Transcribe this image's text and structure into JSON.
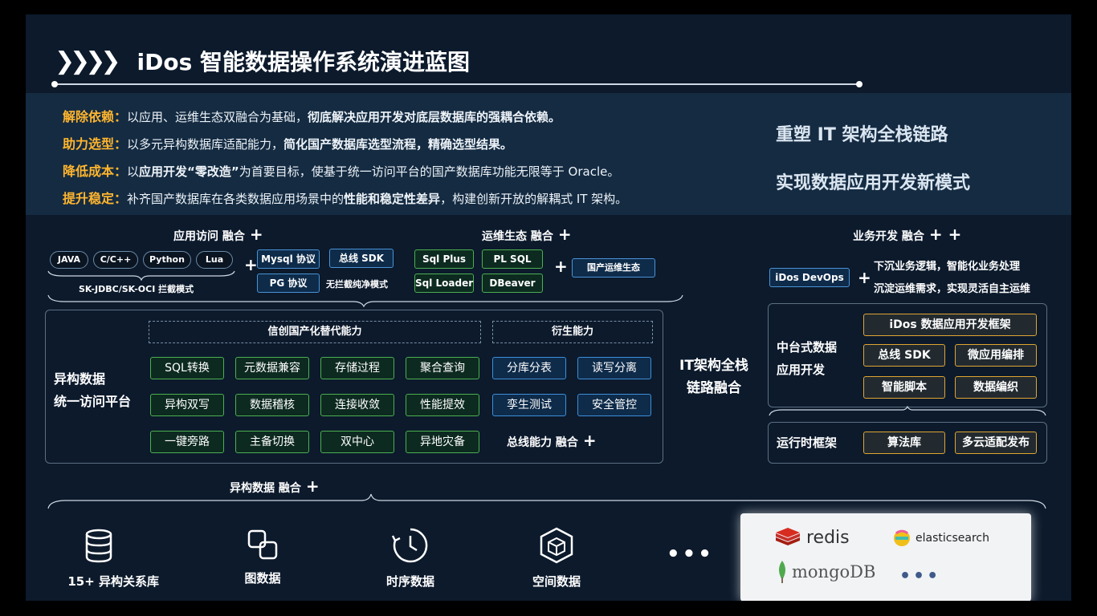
{
  "title": "iDos 智能数据操作系统演进蓝图",
  "goals": [
    {
      "title": "解除依赖",
      "sep": "：",
      "parts": [
        {
          "t": "以应用、运维生态双融合为基础，",
          "b": false
        },
        {
          "t": "彻底解决应用开发对底层数据库的强耦合依赖。",
          "b": true
        }
      ]
    },
    {
      "title": "助力选型",
      "sep": "：",
      "parts": [
        {
          "t": "以多元异构数据库适配能力，",
          "b": false
        },
        {
          "t": "简化国产数据库选型流程，精确选型结果。",
          "b": true
        }
      ]
    },
    {
      "title": "降低成本",
      "sep": "：",
      "parts": [
        {
          "t": "以",
          "b": false
        },
        {
          "t": "应用开发“零改造”",
          "b": true
        },
        {
          "t": "为首要目标，使基于统一访问平台的国产数据库功能无限等于 Oracle。",
          "b": false
        }
      ]
    },
    {
      "title": "提升稳定",
      "sep": "：",
      "parts": [
        {
          "t": "补齐国产数据库在各类数据应用场景中的",
          "b": false
        },
        {
          "t": "性能和稳定性差异",
          "b": true
        },
        {
          "t": "，构建创新开放的解耦式 IT 架构。",
          "b": false
        }
      ]
    }
  ],
  "slogans": [
    "重塑 IT 架构全栈链路",
    "实现数据应用开发新模式"
  ],
  "app_access": {
    "title": "应用访问 融合",
    "languages": [
      "JAVA",
      "C/C++",
      "Python",
      "Lua"
    ],
    "mode_label": "SK-JDBC/SK-OCI 拦截模式",
    "protocols": [
      "Mysql 协议",
      "PG 协议"
    ],
    "sdk": "总线 SDK",
    "sdk_mode": "无拦截纯净模式"
  },
  "ops": {
    "title": "运维生态 融合",
    "tools": [
      "Sql Plus",
      "PL SQL",
      "Sql Loader",
      "DBeaver"
    ],
    "ecosystem": "国产运维生态"
  },
  "business": {
    "title": "业务开发 融合",
    "devops": "iDos DevOps",
    "desc": [
      "下沉业务逻辑，智能化业务处理",
      "沉淀运维需求，实现灵活自主运维"
    ]
  },
  "platform": {
    "name_lines": [
      "异构数据",
      "统一访问平台"
    ],
    "xinchuang_label": "信创国产化替代能力",
    "derived_label": "衍生能力",
    "xinchuang": [
      "SQL转换",
      "元数据兼容",
      "存储过程",
      "聚合查询",
      "异构双写",
      "数据稽核",
      "连接收敛",
      "性能提效",
      "一键旁路",
      "主备切换",
      "双中心",
      "异地灾备"
    ],
    "derived": [
      "分库分表",
      "读写分离",
      "孪生测试",
      "安全管控"
    ],
    "bus_fusion": "总线能力 融合"
  },
  "it_fusion_lines": [
    "IT架构全栈",
    "链路融合"
  ],
  "middle": {
    "name_lines": [
      "中台式数据",
      "应用开发"
    ],
    "framework": "iDos 数据应用开发框架",
    "items": [
      "总线 SDK",
      "微应用编排",
      "智能脚本",
      "数据编织"
    ],
    "runtime_label": "运行时框架",
    "runtime_items": [
      "算法库",
      "多云适配发布"
    ]
  },
  "hetero": {
    "title": "异构数据 融合",
    "categories": [
      {
        "label": "15+ 异构关系库",
        "icon": "database-stack-icon"
      },
      {
        "label": "图数据",
        "icon": "graph-nodes-icon"
      },
      {
        "label": "时序数据",
        "icon": "clock-history-icon"
      },
      {
        "label": "空间数据",
        "icon": "cube-icon"
      }
    ],
    "more": "•••",
    "brands": [
      "redis",
      "elasticsearch",
      "mongoDB"
    ],
    "brands_more": "•••"
  },
  "plus_sign": "+",
  "double_plus": "+ +",
  "colors": {
    "bg": "#0c1a2c",
    "accent_gold": "#ffb52e",
    "green": "#4caf50",
    "blue": "#3d8fd9"
  }
}
